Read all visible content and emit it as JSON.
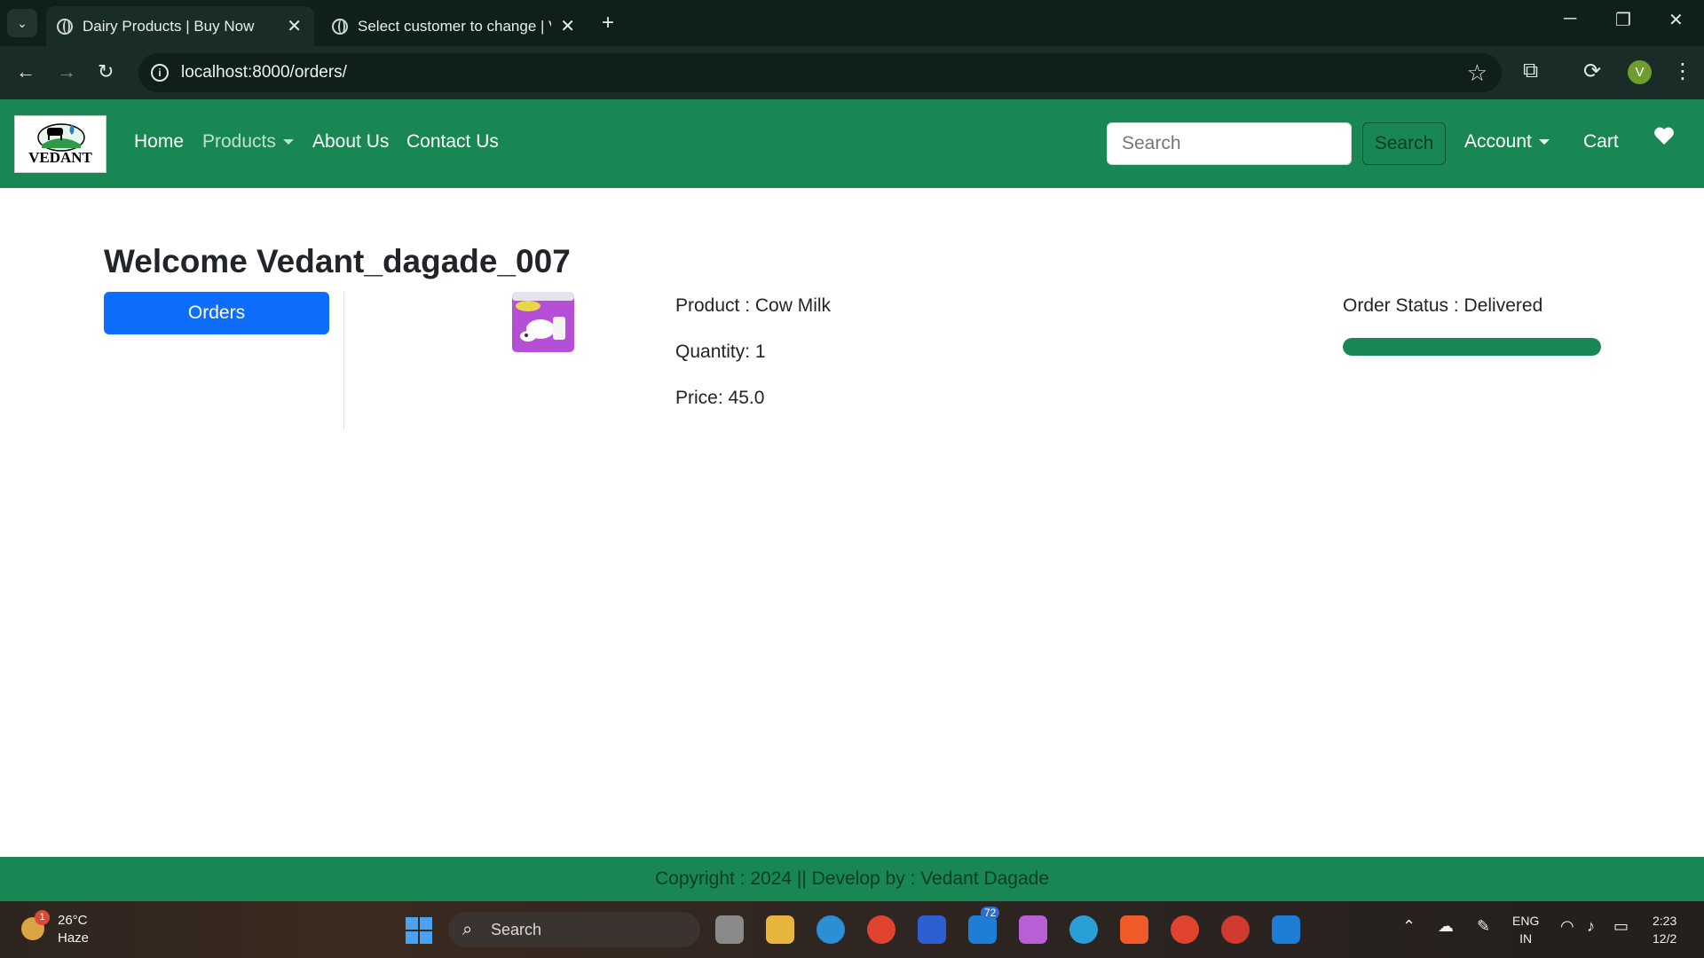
{
  "browser": {
    "tabs": [
      {
        "title": "Dairy Products | Buy Now",
        "active": true
      },
      {
        "title": "Select customer to change | Vedant",
        "active": false
      }
    ],
    "url": "localhost:8000/orders/",
    "profile_initial": "V"
  },
  "navbar": {
    "logo_text": "VEDANT",
    "links": {
      "home": "Home",
      "products": "Products",
      "about": "About Us",
      "contact": "Contact Us",
      "account": "Account",
      "cart": "Cart"
    },
    "search_placeholder": "Search",
    "search_button": "Search"
  },
  "page": {
    "welcome": "Welcome Vedant_dagade_007",
    "orders_button": "Orders"
  },
  "order": {
    "product": "Product : Cow Milk",
    "quantity": "Quantity: 1",
    "price": "Price: 45.0",
    "status": "Order Status : Delivered",
    "progress_fraction": 1.0
  },
  "footer": {
    "text": "Copyright : 2024 || Develop by : Vedant Dagade"
  },
  "taskbar": {
    "temperature": "26°C",
    "weather": "Haze",
    "weather_badge": "1",
    "search_placeholder": "Search",
    "badge_count": "72",
    "language": "ENG",
    "region": "IN",
    "time": "2:23",
    "date": "12/2"
  },
  "colors": {
    "brand_green": "#198754",
    "primary_blue": "#0d6efd"
  }
}
